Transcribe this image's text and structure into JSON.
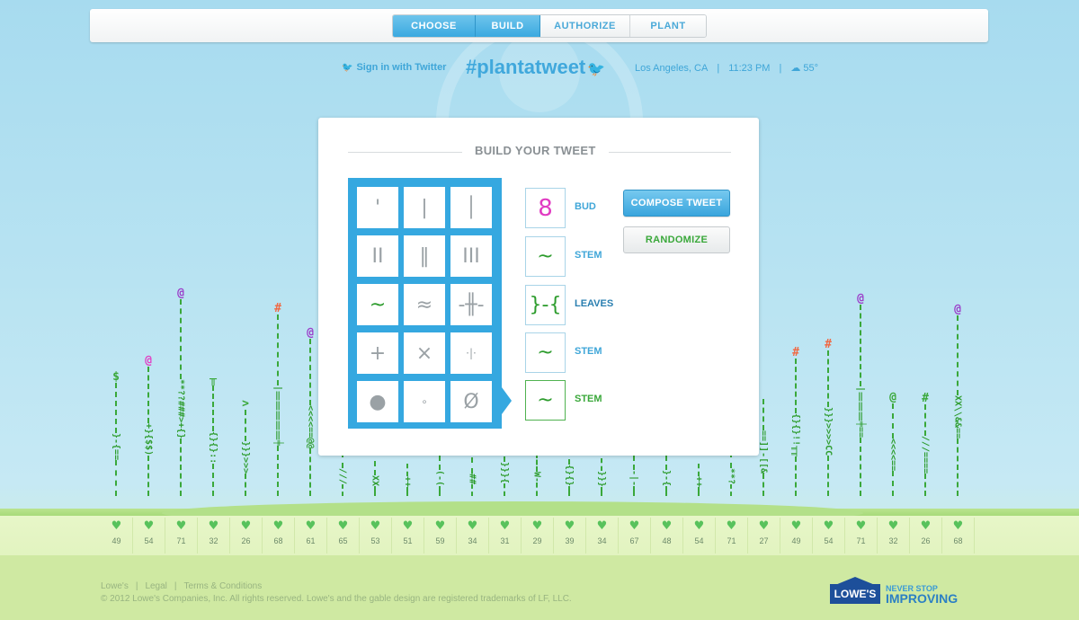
{
  "nav": {
    "steps": [
      {
        "label": "CHOOSE",
        "active": true
      },
      {
        "label": "BUILD",
        "active": true
      },
      {
        "label": "AUTHORIZE",
        "active": false
      },
      {
        "label": "PLANT",
        "active": false
      }
    ]
  },
  "info": {
    "signin": "Sign in with Twitter",
    "hashtag": "#plantatweet",
    "location": "Los Angeles, CA",
    "time": "11:23 PM",
    "temperature": "55°"
  },
  "builder": {
    "title": "BUILD YOUR TWEET",
    "grid": [
      "'",
      "|",
      "│",
      "II",
      "‖",
      "III",
      "~",
      "≈",
      "-╫-",
      "+",
      "×",
      "·|·",
      "●",
      "∘",
      "Ø"
    ],
    "parts": [
      {
        "symbol": "8",
        "label": "BUD"
      },
      {
        "symbol": "~",
        "label": "STEM"
      },
      {
        "symbol": "}-{",
        "label": "LEAVES"
      },
      {
        "symbol": "~",
        "label": "STEM"
      },
      {
        "symbol": "~",
        "label": "STEM"
      }
    ],
    "compose_label": "COMPOSE TWEET",
    "randomize_label": "RANDOMIZE"
  },
  "plants": [
    {
      "bloom": "$",
      "glyphs": "}-{==",
      "color": "green",
      "height": 170
    },
    {
      "bloom": "@",
      "glyphs": "+}{$$)",
      "color": "pink",
      "height": 190
    },
    {
      "bloom": "@",
      "glyphs": "**??###>+{}",
      "color": "purple",
      "height": 265
    },
    {
      "bloom": "╥",
      "glyphs": "{}{}::",
      "color": "green",
      "height": 155
    },
    {
      "bloom": ">",
      "glyphs": "}}}>>>",
      "color": "green",
      "height": 110
    },
    {
      "bloom": "#",
      "glyphs": "|‖‖‖‖‖╪",
      "color": "orange",
      "height": 235
    },
    {
      "bloom": "@",
      "glyphs": "<<<<==@@",
      "color": "purple",
      "height": 220
    },
    {
      "bloom": "",
      "glyphs": "///",
      "color": "green",
      "height": 60
    },
    {
      "bloom": "",
      "glyphs": "XX",
      "color": "green",
      "height": 55
    },
    {
      "bloom": "",
      "glyphs": "++",
      "color": "green",
      "height": 50
    },
    {
      "bloom": "",
      "glyphs": "(-(",
      "color": "green",
      "height": 55
    },
    {
      "bloom": "",
      "glyphs": "##",
      "color": "green",
      "height": 60
    },
    {
      "bloom": "",
      "glyphs": "}}}{",
      "color": "green",
      "height": 65
    },
    {
      "bloom": "",
      "glyphs": "W-",
      "color": "green",
      "height": 70
    },
    {
      "bloom": "",
      "glyphs": "{}{}",
      "color": "green",
      "height": 55
    },
    {
      "bloom": "",
      "glyphs": "}}}",
      "color": "green",
      "height": 50
    },
    {
      "bloom": "",
      "glyphs": "-|-",
      "color": "green",
      "height": 55
    },
    {
      "bloom": "",
      "glyphs": "}-{",
      "color": "green",
      "height": 55
    },
    {
      "bloom": "",
      "glyphs": "++",
      "color": "green",
      "height": 50
    },
    {
      "bloom": "",
      "glyphs": "**?",
      "color": "green",
      "height": 60
    },
    {
      "bloom": "",
      "glyphs": "==]]-[[&",
      "color": "green",
      "height": 110
    },
    {
      "bloom": "#",
      "glyphs": "{}{}!!╥╥",
      "color": "orange",
      "height": 185
    },
    {
      "bloom": "#",
      "glyphs": "}}}>>>>CC",
      "color": "orange",
      "height": 190
    },
    {
      "bloom": "@",
      "glyphs": "|‖‖‖╪==",
      "color": "purple",
      "height": 270
    },
    {
      "bloom": "@",
      "glyphs": "<<<<==",
      "color": "green",
      "height": 120
    },
    {
      "bloom": "#",
      "glyphs": "///====",
      "color": "green",
      "height": 110
    },
    {
      "bloom": "@",
      "glyphs": "XX\\\\&&==",
      "color": "purple",
      "height": 265
    }
  ],
  "hearts": [
    49,
    54,
    71,
    32,
    26,
    68,
    61,
    65,
    53,
    51,
    59,
    34,
    31,
    29,
    39,
    34,
    67,
    48,
    54,
    71,
    27,
    49,
    54,
    71,
    32,
    26,
    68
  ],
  "footer": {
    "links": [
      "Lowe's",
      "Legal",
      "Terms & Conditions"
    ],
    "copyright": "© 2012 Lowe's Companies, Inc. All rights reserved. Lowe's and the gable design are registered trademarks of LF, LLC.",
    "logo_text": "LOWE'S",
    "tagline_1": "NEVER STOP",
    "tagline_2": "IMPROVING"
  },
  "colors": {
    "accent": "#3aa9e0",
    "green": "#3aa83a",
    "bud_pink": "#e13bc2"
  }
}
